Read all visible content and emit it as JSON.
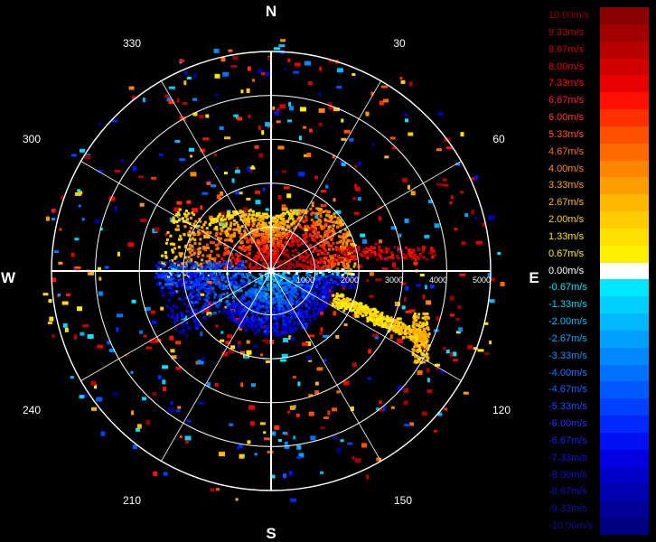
{
  "cardinals": {
    "north": "N",
    "south": "S",
    "east": "E",
    "west": "W"
  },
  "angle_labels": [
    "30",
    "60",
    "120",
    "150",
    "210",
    "240",
    "300",
    "330"
  ],
  "range_labels": [
    "1000",
    "2000",
    "3000",
    "4000",
    "5000"
  ],
  "range_max": 5000,
  "legend": {
    "items": [
      {
        "label": "10.00m/s",
        "color": "#8b0000",
        "text_color": "#8b0000"
      },
      {
        "label": "9.33m/s",
        "color": "#a00000",
        "text_color": "#b00000"
      },
      {
        "label": "8.67m/s",
        "color": "#b80000",
        "text_color": "#c80000"
      },
      {
        "label": "8.00m/s",
        "color": "#d00000",
        "text_color": "#e00000"
      },
      {
        "label": "7.33m/s",
        "color": "#e60000",
        "text_color": "#ff0000"
      },
      {
        "label": "6.67m/s",
        "color": "#ff1000",
        "text_color": "#ff2020"
      },
      {
        "label": "6.00m/s",
        "color": "#ff3000",
        "text_color": "#ff3a1a"
      },
      {
        "label": "5.33m/s",
        "color": "#ff5000",
        "text_color": "#ff5a20"
      },
      {
        "label": "4.67m/s",
        "color": "#ff6a00",
        "text_color": "#ff7020"
      },
      {
        "label": "4.00m/s",
        "color": "#ff8400",
        "text_color": "#ff8a20"
      },
      {
        "label": "3.33m/s",
        "color": "#ff9e00",
        "text_color": "#ffa020"
      },
      {
        "label": "2.67m/s",
        "color": "#ffb800",
        "text_color": "#ffb820"
      },
      {
        "label": "2.00m/s",
        "color": "#ffcc00",
        "text_color": "#ffcc20"
      },
      {
        "label": "1.33m/s",
        "color": "#ffe000",
        "text_color": "#ffe020"
      },
      {
        "label": "0.67m/s",
        "color": "#fff000",
        "text_color": "#fff020"
      },
      {
        "label": "0.00m/s",
        "color": "#ffffff",
        "text_color": "#ffffff"
      },
      {
        "label": "-0.67m/s",
        "color": "#00e8ff",
        "text_color": "#00e8ff"
      },
      {
        "label": "-1.33m/s",
        "color": "#00d0ff",
        "text_color": "#00d4ff"
      },
      {
        "label": "-2.00m/s",
        "color": "#00b8ff",
        "text_color": "#00bcff"
      },
      {
        "label": "-2.67m/s",
        "color": "#00a0ff",
        "text_color": "#10a8ff"
      },
      {
        "label": "-3.33m/s",
        "color": "#0088ff",
        "text_color": "#1890ff"
      },
      {
        "label": "-4.00m/s",
        "color": "#0070ff",
        "text_color": "#2078ff"
      },
      {
        "label": "-4.67m/s",
        "color": "#0058ff",
        "text_color": "#2060ff"
      },
      {
        "label": "-5.33m/s",
        "color": "#0040ff",
        "text_color": "#2048ff"
      },
      {
        "label": "-6.00m/s",
        "color": "#0028ff",
        "text_color": "#2030ff"
      },
      {
        "label": "-6.67m/s",
        "color": "#0010f0",
        "text_color": "#1820f0"
      },
      {
        "label": "-7.33m/s",
        "color": "#0000e0",
        "text_color": "#1010e0"
      },
      {
        "label": "-8.00m/s",
        "color": "#0000c8",
        "text_color": "#1010d0"
      },
      {
        "label": "-8.67m/s",
        "color": "#0000b0",
        "text_color": "#1010c0"
      },
      {
        "label": "-9.33m/s",
        "color": "#000098",
        "text_color": "#1010a8"
      },
      {
        "label": "-10.00m/s",
        "color": "#000080",
        "text_color": "#101090"
      }
    ]
  }
}
